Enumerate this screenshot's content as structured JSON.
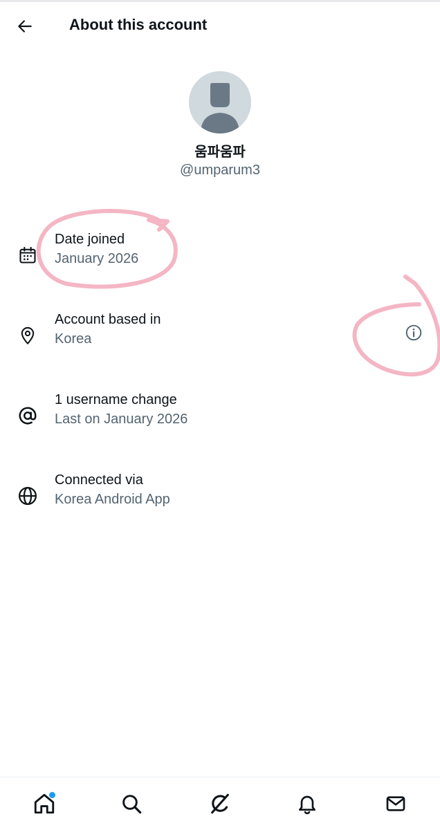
{
  "header": {
    "title": "About this account",
    "back_icon": "arrow-left-icon"
  },
  "profile": {
    "display_name": "움파움파",
    "handle": "@umparum3",
    "avatar_icon": "default-avatar-icon"
  },
  "info": [
    {
      "icon": "calendar-icon",
      "label": "Date joined",
      "value": "January 2026"
    },
    {
      "icon": "location-pin-icon",
      "label": "Account based in",
      "value": "Korea",
      "action_icon": "info-icon"
    },
    {
      "icon": "at-sign-icon",
      "label": "1 username change",
      "value": "Last on January 2026"
    },
    {
      "icon": "globe-icon",
      "label": "Connected via",
      "value": "Korea Android App"
    }
  ],
  "bottom_nav": [
    {
      "name": "home",
      "icon": "home-icon",
      "has_notification_dot": true
    },
    {
      "name": "search",
      "icon": "search-icon"
    },
    {
      "name": "grok",
      "icon": "grok-icon"
    },
    {
      "name": "notifications",
      "icon": "bell-icon"
    },
    {
      "name": "messages",
      "icon": "mail-icon"
    }
  ],
  "colors": {
    "text_primary": "#0f1419",
    "text_secondary": "#536471",
    "avatar_bg": "#cfd9de",
    "avatar_fg": "#6b7886",
    "accent": "#1d9bf0",
    "annotation_pink": "#f4b6c4"
  }
}
